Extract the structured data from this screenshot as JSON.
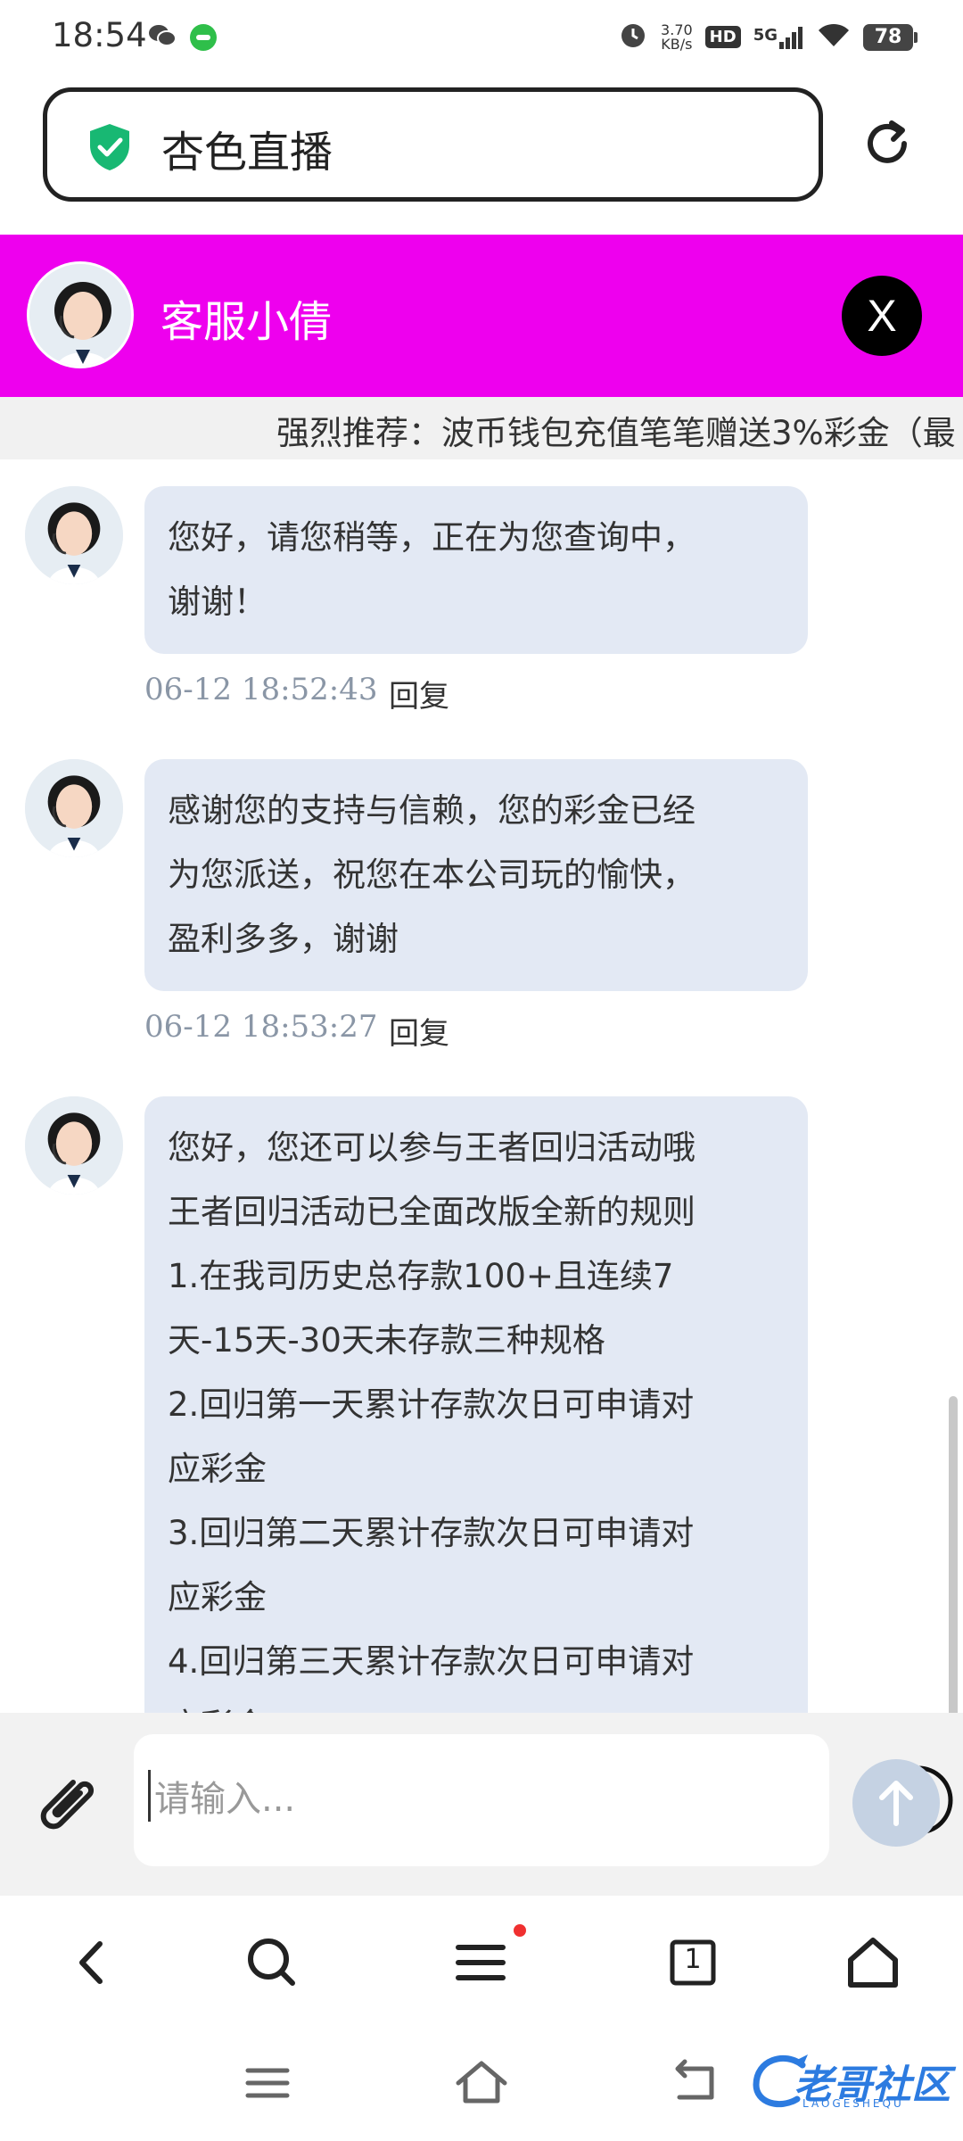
{
  "status_bar": {
    "time": "18:54",
    "net_speed": "3.70",
    "net_speed_unit": "KB/s",
    "hd": "HD",
    "network": "5G",
    "battery": "78"
  },
  "browser": {
    "page_title": "杏色直播",
    "nav_tab_count": "1"
  },
  "chat": {
    "agent_name": "客服小倩",
    "close_label": "X",
    "marquee": "强烈推荐：波币钱包充值笔笔赠送3%彩金（最",
    "reply_label": "回复",
    "messages": [
      {
        "lines": [
          "您好，请您稍等，正在为您查询中，",
          "谢谢！"
        ],
        "time": "06-12 18:52:43"
      },
      {
        "lines": [
          "感谢您的支持与信赖，您的彩金已经",
          "为您派送，祝您在本公司玩的愉快，",
          "盈利多多，谢谢"
        ],
        "time": "06-12 18:53:27"
      },
      {
        "lines": [
          "您好，您还可以参与王者回归活动哦",
          "王者回归活动已全面改版全新的规则",
          "1.在我司历史总存款100+且连续7",
          "天-15天-30天未存款三种规格",
          "2.回归第一天累计存款次日可申请对",
          "应彩金",
          "3.回归第二天累计存款次日可申请对",
          "应彩金",
          "4.回归第三天累计存款次日可申请对",
          "应彩金"
        ],
        "time": ""
      }
    ],
    "input_placeholder": "请输入..."
  },
  "watermark": {
    "text": "老哥社区",
    "sub": "LAOGESHEQU"
  },
  "colors": {
    "header_bg": "#ee00ee",
    "bubble_bg": "#e3e9f4",
    "shield": "#18b873",
    "send_btn": "#c5d2e3"
  }
}
